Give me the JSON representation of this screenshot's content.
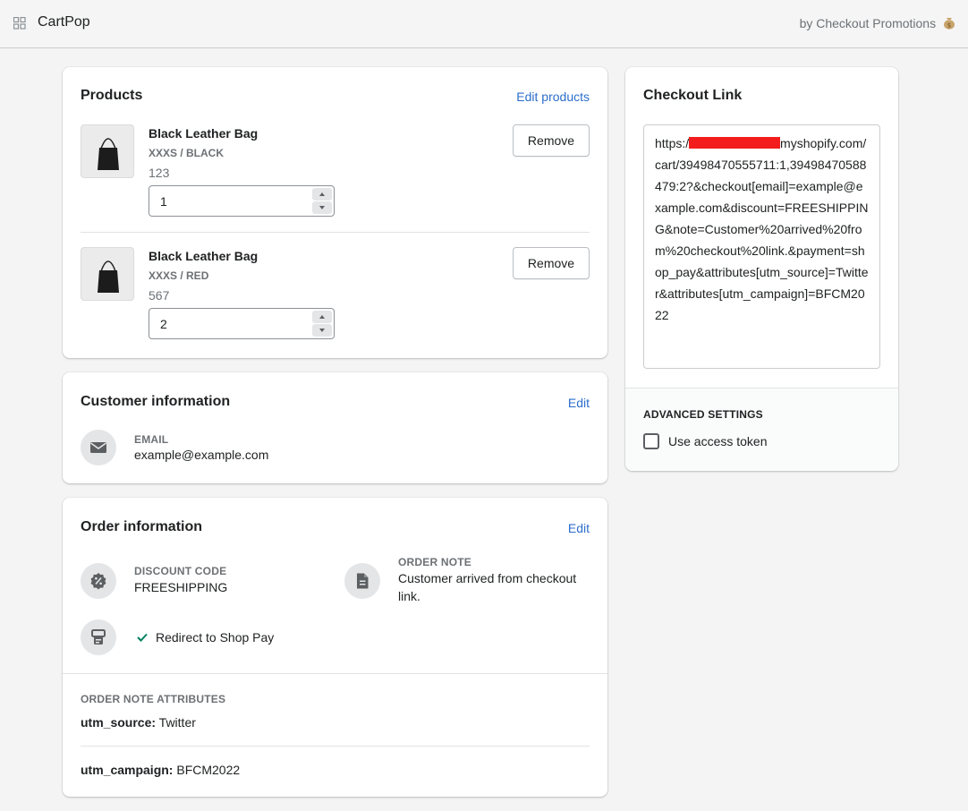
{
  "header": {
    "app_title": "CartPop",
    "by_text": "by Checkout Promotions"
  },
  "products": {
    "title": "Products",
    "edit_link": "Edit products",
    "items": [
      {
        "name": "Black Leather Bag",
        "variant": "XXXS / BLACK",
        "sku": "123",
        "quantity": "1",
        "remove_label": "Remove"
      },
      {
        "name": "Black Leather Bag",
        "variant": "XXXS / RED",
        "sku": "567",
        "quantity": "2",
        "remove_label": "Remove"
      }
    ]
  },
  "customer": {
    "title": "Customer information",
    "edit_link": "Edit",
    "email_label": "EMAIL",
    "email_value": "example@example.com"
  },
  "order": {
    "title": "Order information",
    "edit_link": "Edit",
    "discount_label": "DISCOUNT CODE",
    "discount_value": "FREESHIPPING",
    "note_label": "ORDER NOTE",
    "note_value": "Customer arrived from checkout link.",
    "redirect_label": "Redirect to Shop Pay",
    "attributes_label": "ORDER NOTE ATTRIBUTES",
    "attributes": [
      {
        "key": "utm_source:",
        "value": "Twitter"
      },
      {
        "key": "utm_campaign:",
        "value": "BFCM2022"
      }
    ]
  },
  "checkout": {
    "title": "Checkout Link",
    "link_start": "https://",
    "link_rest": "myshopify.com/cart/39498470555711:1,39498470588479:2?&checkout[email]=example@example.com&discount=FREESHIPPING&note=Customer%20arrived%20from%20checkout%20link.&payment=shop_pay&attributes[utm_source]=Twitter&attributes[utm_campaign]=BFCM2022",
    "advanced_label": "ADVANCED SETTINGS",
    "access_token_label": "Use access token"
  },
  "colors": {
    "link": "#2c6ecb",
    "check": "#008060",
    "redaction": "#f31d1d"
  }
}
